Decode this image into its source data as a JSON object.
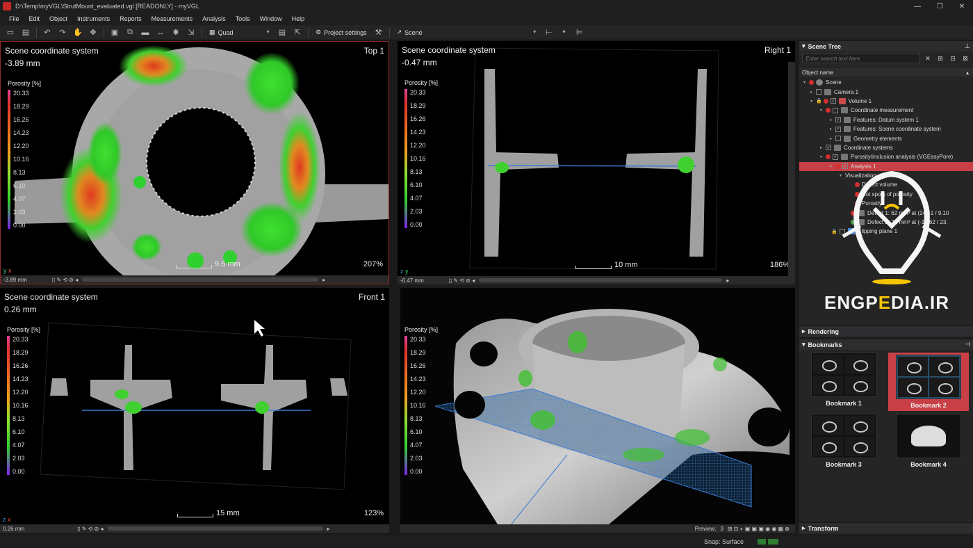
{
  "window": {
    "title": "D:\\Temp\\myVGL\\StrutMount_evaluated.vgl [READONLY] - myVGL",
    "controls": [
      "—",
      "❐",
      "✕"
    ]
  },
  "menu": [
    "File",
    "Edit",
    "Object",
    "Instruments",
    "Reports",
    "Measurements",
    "Analysis",
    "Tools",
    "Window",
    "Help"
  ],
  "toolbar": {
    "layout_label": "Quad",
    "project_settings_label": "Project settings",
    "scene_label": "Scene"
  },
  "views": {
    "top": {
      "coord_system": "Scene coordinate system",
      "position": "-3.89 mm",
      "name": "Top 1",
      "scale": "9.5 mm",
      "zoom": "207%",
      "bottom_value": "-3.89 mm",
      "axis_v": "y",
      "axis_h": "x"
    },
    "right": {
      "coord_system": "Scene coordinate system",
      "position": "-0.47 mm",
      "name": "Right 1",
      "scale": "10 mm",
      "zoom": "186%",
      "bottom_value": "-0.47 mm",
      "axis_v": "z",
      "axis_h": "y"
    },
    "front": {
      "coord_system": "Scene coordinate system",
      "position": "0.26 mm",
      "name": "Front 1",
      "scale": "15 mm",
      "zoom": "123%",
      "bottom_value": "0.26 mm",
      "axis_v": "z",
      "axis_h": "x"
    },
    "perspective": {
      "preview_label": "Preview:",
      "preview_value": "3"
    }
  },
  "legend": {
    "title": "Porosity [%]",
    "ticks": [
      "20.33",
      "18.29",
      "16.26",
      "14.23",
      "12.20",
      "10.16",
      "8.13",
      "6.10",
      "4.07",
      "2.03",
      "0.00"
    ]
  },
  "scene_tree": {
    "header": "Scene Tree",
    "search_placeholder": "Enter search text here",
    "column": "Object name",
    "rows": [
      {
        "label": "Scene",
        "indent": 0
      },
      {
        "label": "Camera 1",
        "indent": 1
      },
      {
        "label": "Volume 1",
        "indent": 1
      },
      {
        "label": "Coordinate measurement",
        "indent": 2
      },
      {
        "label": "Features: Datum system 1",
        "indent": 3
      },
      {
        "label": "Features: Scene coordinate system",
        "indent": 3
      },
      {
        "label": "Geometry elements",
        "indent": 3
      },
      {
        "label": "Coordinate systems",
        "indent": 2
      },
      {
        "label": "Porosity/inclusion analysis (VGEasyPore)",
        "indent": 2
      },
      {
        "label": "Analysis 1",
        "indent": 3
      },
      {
        "label": "Visualization of results",
        "indent": 4
      },
      {
        "label": "Defect volume",
        "indent": 5
      },
      {
        "label": "Hot spots of porosity",
        "indent": 5
      },
      {
        "label": "Porosity",
        "indent": 5
      },
      {
        "label": "Defect 1: 62 mm³ at (24.41 / 9.10",
        "indent": 4
      },
      {
        "label": "Defect 2: 22 mm³ at (-15.62 / 23.",
        "indent": 4
      },
      {
        "label": "Clipping plane 1",
        "indent": 1
      }
    ]
  },
  "rendering": {
    "header": "Rendering"
  },
  "bookmarks": {
    "header": "Bookmarks",
    "items": [
      "Bookmark 1",
      "Bookmark 2",
      "Bookmark 3",
      "Bookmark 4"
    ]
  },
  "transform": {
    "header": "Transform"
  },
  "status": {
    "snap": "Snap: Surface"
  },
  "watermark": {
    "text_a": "ENGP",
    "text_b": "E",
    "text_c": "DIA.IR"
  },
  "colors": {
    "accent": "#c93f46",
    "background": "#1b1b1b",
    "porosity_hot": "#e03030",
    "porosity_low": "#30d030"
  }
}
